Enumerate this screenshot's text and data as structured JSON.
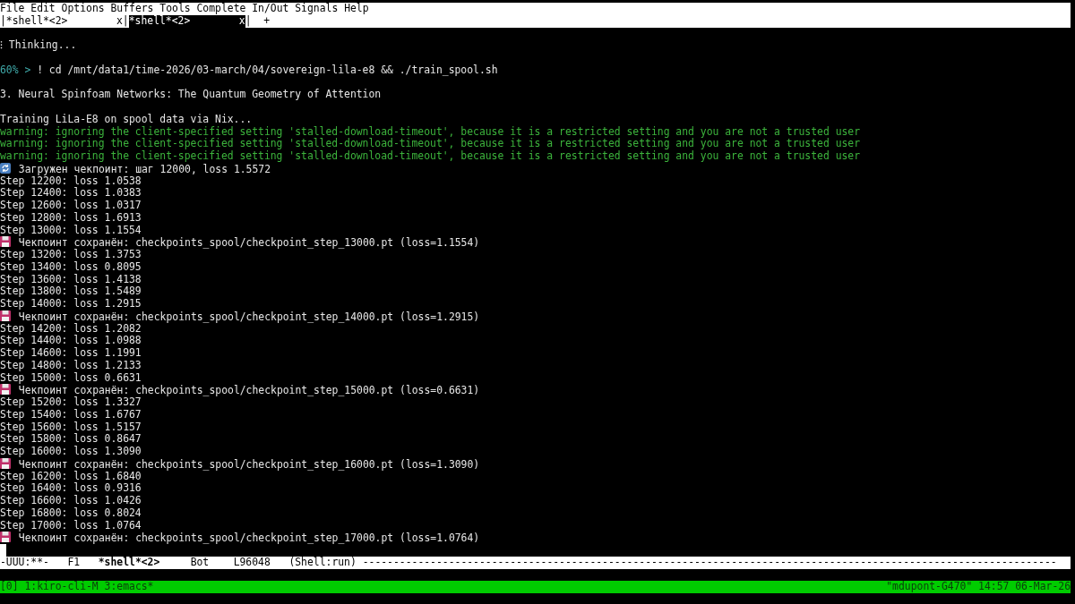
{
  "menu_bar": [
    "File",
    "Edit",
    "Options",
    "Buffers",
    "Tools",
    "Complete",
    "In/Out",
    "Signals",
    "Help"
  ],
  "tab_bar": {
    "separator": "|",
    "new_tab": "+",
    "tabs": [
      {
        "label": "*shell*<2>",
        "close": "x",
        "selected": false
      },
      {
        "label": "*shell*<2>",
        "close": "x",
        "selected": true
      }
    ]
  },
  "terminal": {
    "lines": [
      {
        "kind": "blank"
      },
      {
        "kind": "plain",
        "text": "⁝ Thinking..."
      },
      {
        "kind": "blank"
      },
      {
        "kind": "prompt",
        "percent": "60%",
        "arrow": ">",
        "text": "! cd /mnt/data1/time-2026/03-march/04/sovereign-lila-e8 && ./train_spool.sh"
      },
      {
        "kind": "blank"
      },
      {
        "kind": "plain",
        "text": "3. Neural Spinfoam Networks: The Quantum Geometry of Attention"
      },
      {
        "kind": "blank"
      },
      {
        "kind": "plain",
        "text": "Training LiLa-E8 on spool data via Nix..."
      },
      {
        "kind": "warning",
        "text": "warning: ignoring the client-specified setting 'stalled-download-timeout', because it is a restricted setting and you are not a trusted user"
      },
      {
        "kind": "warning",
        "text": "warning: ignoring the client-specified setting 'stalled-download-timeout', because it is a restricted setting and you are not a trusted user"
      },
      {
        "kind": "warning",
        "text": "warning: ignoring the client-specified setting 'stalled-download-timeout', because it is a restricted setting and you are not a trusted user"
      },
      {
        "kind": "loaded",
        "text": "Загружен чекпоинт: шаг 12000, loss 1.5572"
      },
      {
        "kind": "plain",
        "text": "Step 12200: loss 1.0538"
      },
      {
        "kind": "plain",
        "text": "Step 12400: loss 1.0383"
      },
      {
        "kind": "plain",
        "text": "Step 12600: loss 1.0317"
      },
      {
        "kind": "plain",
        "text": "Step 12800: loss 1.6913"
      },
      {
        "kind": "plain",
        "text": "Step 13000: loss 1.1554"
      },
      {
        "kind": "saved",
        "text": "Чекпоинт сохранён: checkpoints_spool/checkpoint_step_13000.pt (loss=1.1554)"
      },
      {
        "kind": "plain",
        "text": "Step 13200: loss 1.3753"
      },
      {
        "kind": "plain",
        "text": "Step 13400: loss 0.8095"
      },
      {
        "kind": "plain",
        "text": "Step 13600: loss 1.4138"
      },
      {
        "kind": "plain",
        "text": "Step 13800: loss 1.5489"
      },
      {
        "kind": "plain",
        "text": "Step 14000: loss 1.2915"
      },
      {
        "kind": "saved",
        "text": "Чекпоинт сохранён: checkpoints_spool/checkpoint_step_14000.pt (loss=1.2915)"
      },
      {
        "kind": "plain",
        "text": "Step 14200: loss 1.2082"
      },
      {
        "kind": "plain",
        "text": "Step 14400: loss 1.0988"
      },
      {
        "kind": "plain",
        "text": "Step 14600: loss 1.1991"
      },
      {
        "kind": "plain",
        "text": "Step 14800: loss 1.2133"
      },
      {
        "kind": "plain",
        "text": "Step 15000: loss 0.6631"
      },
      {
        "kind": "saved",
        "text": "Чекпоинт сохранён: checkpoints_spool/checkpoint_step_15000.pt (loss=0.6631)"
      },
      {
        "kind": "plain",
        "text": "Step 15200: loss 1.3327"
      },
      {
        "kind": "plain",
        "text": "Step 15400: loss 1.6767"
      },
      {
        "kind": "plain",
        "text": "Step 15600: loss 1.5157"
      },
      {
        "kind": "plain",
        "text": "Step 15800: loss 0.8647"
      },
      {
        "kind": "plain",
        "text": "Step 16000: loss 1.3090"
      },
      {
        "kind": "saved",
        "text": "Чекпоинт сохранён: checkpoints_spool/checkpoint_step_16000.pt (loss=1.3090)"
      },
      {
        "kind": "plain",
        "text": "Step 16200: loss 1.6840"
      },
      {
        "kind": "plain",
        "text": "Step 16400: loss 0.9316"
      },
      {
        "kind": "plain",
        "text": "Step 16600: loss 1.0426"
      },
      {
        "kind": "plain",
        "text": "Step 16800: loss 0.8024"
      },
      {
        "kind": "plain",
        "text": "Step 17000: loss 1.0764"
      },
      {
        "kind": "saved",
        "text": "Чекпоинт сохранён: checkpoints_spool/checkpoint_step_17000.pt (loss=1.0764)"
      },
      {
        "kind": "cursor"
      }
    ]
  },
  "mode_line": {
    "status": "-UUU:**-",
    "frame": "F1",
    "buffer": "*shell*<2>",
    "position": "Bot",
    "line": "L96048",
    "mode": "(Shell:run)",
    "fill": "-----------------------------------------------------------------------------------------------------------------"
  },
  "tmux_bar": {
    "session": "[0]",
    "windows": [
      "1:kiro-cli-M",
      "3:emacs*"
    ],
    "host": "\"mdupont-G470\"",
    "time": "14:57",
    "date": "06-Mar-26"
  }
}
